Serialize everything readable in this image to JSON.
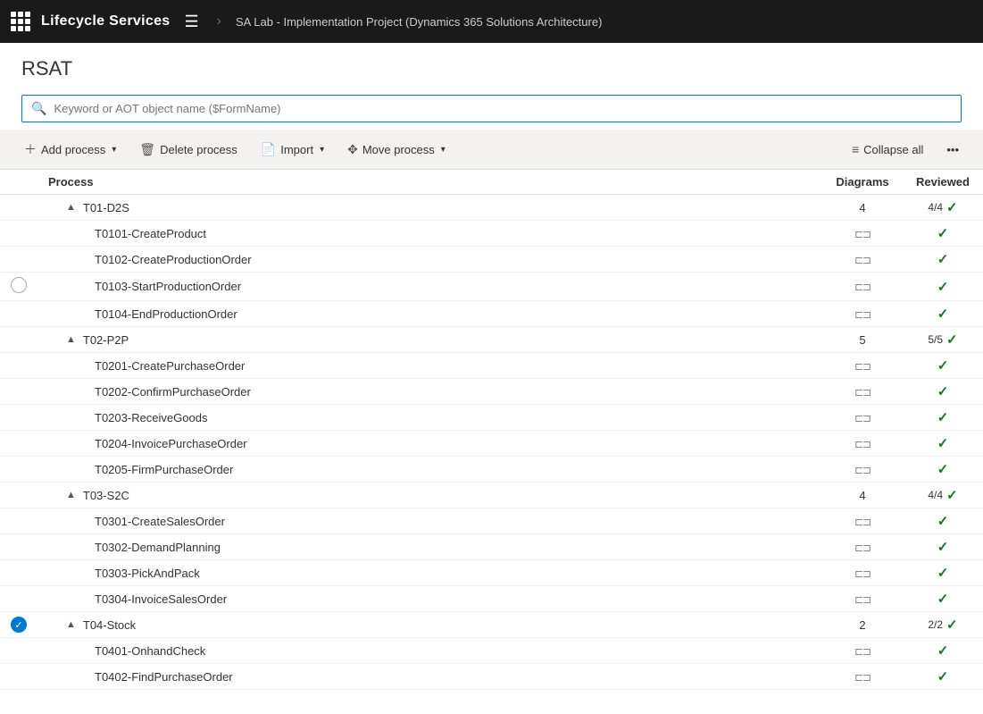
{
  "nav": {
    "title": "Lifecycle Services",
    "breadcrumb": "SA Lab - Implementation Project (Dynamics 365 Solutions Architecture)"
  },
  "page": {
    "title": "RSAT"
  },
  "search": {
    "placeholder": "Keyword or AOT object name ($FormName)"
  },
  "toolbar": {
    "add_process": "Add process",
    "delete_process": "Delete process",
    "import": "Import",
    "move_process": "Move process",
    "collapse_all": "Collapse all"
  },
  "table": {
    "columns": [
      "Process",
      "Diagrams",
      "Reviewed"
    ],
    "rows": [
      {
        "id": "t01",
        "type": "group",
        "name": "T01-D2S",
        "diagrams": "4",
        "reviewed": "4/4",
        "reviewed_check": true,
        "expanded": true,
        "selector": "none"
      },
      {
        "id": "t0101",
        "type": "child",
        "name": "T0101-CreateProduct",
        "diagrams": "icon",
        "reviewed_check": true,
        "selector": "none"
      },
      {
        "id": "t0102",
        "type": "child",
        "name": "T0102-CreateProductionOrder",
        "diagrams": "icon",
        "reviewed_check": true,
        "selector": "none"
      },
      {
        "id": "t0103",
        "type": "child",
        "name": "T0103-StartProductionOrder",
        "diagrams": "icon",
        "reviewed_check": true,
        "selector": "circle"
      },
      {
        "id": "t0104",
        "type": "child",
        "name": "T0104-EndProductionOrder",
        "diagrams": "icon",
        "reviewed_check": true,
        "selector": "none"
      },
      {
        "id": "t02",
        "type": "group",
        "name": "T02-P2P",
        "diagrams": "5",
        "reviewed": "5/5",
        "reviewed_check": true,
        "expanded": true,
        "selector": "none"
      },
      {
        "id": "t0201",
        "type": "child",
        "name": "T0201-CreatePurchaseOrder",
        "diagrams": "icon",
        "reviewed_check": true,
        "selector": "none"
      },
      {
        "id": "t0202",
        "type": "child",
        "name": "T0202-ConfirmPurchaseOrder",
        "diagrams": "icon",
        "reviewed_check": true,
        "selector": "none"
      },
      {
        "id": "t0203",
        "type": "child",
        "name": "T0203-ReceiveGoods",
        "diagrams": "icon",
        "reviewed_check": true,
        "selector": "none"
      },
      {
        "id": "t0204",
        "type": "child",
        "name": "T0204-InvoicePurchaseOrder",
        "diagrams": "icon",
        "reviewed_check": true,
        "selector": "none"
      },
      {
        "id": "t0205",
        "type": "child",
        "name": "T0205-FirmPurchaseOrder",
        "diagrams": "icon",
        "reviewed_check": true,
        "selector": "none"
      },
      {
        "id": "t03",
        "type": "group",
        "name": "T03-S2C",
        "diagrams": "4",
        "reviewed": "4/4",
        "reviewed_check": true,
        "expanded": true,
        "selector": "none"
      },
      {
        "id": "t0301",
        "type": "child",
        "name": "T0301-CreateSalesOrder",
        "diagrams": "icon",
        "reviewed_check": true,
        "selector": "none"
      },
      {
        "id": "t0302",
        "type": "child",
        "name": "T0302-DemandPlanning",
        "diagrams": "icon",
        "reviewed_check": true,
        "selector": "none"
      },
      {
        "id": "t0303",
        "type": "child",
        "name": "T0303-PickAndPack",
        "diagrams": "icon",
        "reviewed_check": true,
        "selector": "none"
      },
      {
        "id": "t0304",
        "type": "child",
        "name": "T0304-InvoiceSalesOrder",
        "diagrams": "icon",
        "reviewed_check": true,
        "selector": "none"
      },
      {
        "id": "t04",
        "type": "group",
        "name": "T04-Stock",
        "diagrams": "2",
        "reviewed": "2/2",
        "reviewed_check": true,
        "expanded": true,
        "selector": "checked",
        "selected": true
      },
      {
        "id": "t0401",
        "type": "child",
        "name": "T0401-OnhandCheck",
        "diagrams": "icon",
        "reviewed_check": true,
        "selector": "none"
      },
      {
        "id": "t0402",
        "type": "child",
        "name": "T0402-FindPurchaseOrder",
        "diagrams": "icon",
        "reviewed_check": true,
        "selector": "none"
      }
    ]
  }
}
